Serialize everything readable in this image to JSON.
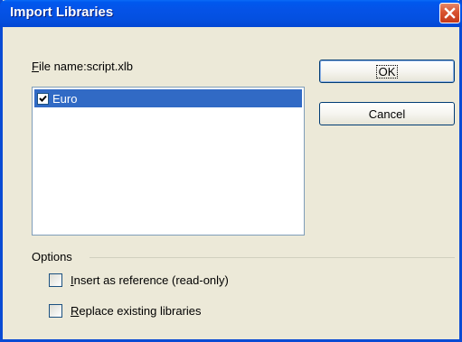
{
  "window": {
    "title": "Import Libraries"
  },
  "file": {
    "label_accel": "F",
    "label_rest": "ile name:",
    "value": "script.xlb"
  },
  "library_list": {
    "items": [
      {
        "label": "Euro",
        "checked": true,
        "selected": true
      }
    ]
  },
  "buttons": {
    "ok_label": "OK",
    "cancel_label": "Cancel"
  },
  "options": {
    "label": "Options",
    "insert_reference": {
      "accel": "I",
      "rest": "nsert as reference (read-only)",
      "checked": false
    },
    "replace_existing": {
      "accel": "R",
      "rest": "eplace existing libraries",
      "checked": false
    }
  },
  "colors": {
    "title_bar": "#0552e6",
    "selection": "#316ac5",
    "close_button": "#d9532f",
    "dialog_bg": "#ece9d8"
  },
  "icons": {
    "close": "close-icon",
    "check": "checkmark-icon"
  }
}
